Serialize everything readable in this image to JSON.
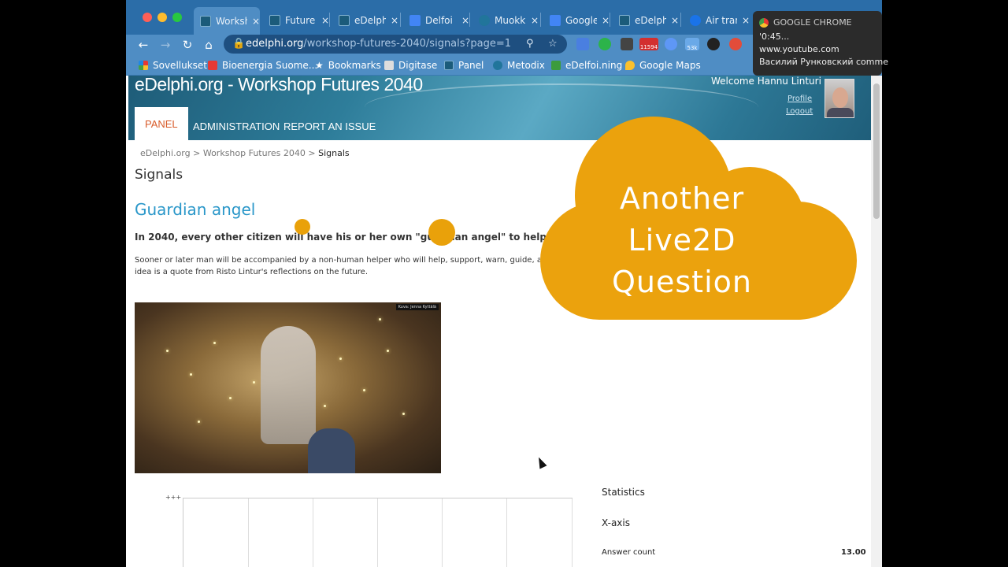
{
  "browser": {
    "tabs": [
      {
        "label": "Worksh",
        "active": true,
        "color": "#1b5b7a"
      },
      {
        "label": "Future",
        "color": "#1b5b7a"
      },
      {
        "label": "eDelphi",
        "color": "#1b5b7a"
      },
      {
        "label": "Delfoi",
        "color": "#4285f4"
      },
      {
        "label": "Muokk",
        "color": "#21759b"
      },
      {
        "label": "Google",
        "color": "#4285f4"
      },
      {
        "label": "eDelphi",
        "color": "#1b5b7a"
      },
      {
        "label": "Air tran",
        "color": "#1a73e8"
      }
    ],
    "tab_close": "×",
    "url_host": "edelphi.org",
    "url_path": "/workshop-futures-2040/signals?page=1",
    "extension_badge": "11594",
    "extension_badge2": "53k",
    "bookmarks": [
      {
        "label": "Sovellukset"
      },
      {
        "label": "Bioenergia Suome..."
      },
      {
        "label": "Bookmarks"
      },
      {
        "label": "Digitase"
      },
      {
        "label": "Panel"
      },
      {
        "label": "Metodix"
      },
      {
        "label": "eDelfoi.ning"
      },
      {
        "label": "Google Maps"
      }
    ]
  },
  "notification": {
    "app": "GOOGLE CHROME",
    "line1": "'0:45...",
    "line2": "www.youtube.com",
    "line3": "Василий Рунковский comme"
  },
  "site": {
    "title": "eDelphi.org - Workshop Futures 2040",
    "welcome": "Welcome  Hannu Linturi",
    "profile": "Profile",
    "logout": "Logout",
    "nav": [
      "PANEL",
      "ADMINISTRATION",
      "REPORT AN ISSUE"
    ]
  },
  "breadcrumb": {
    "root": "eDelphi.org",
    "sep": ">",
    "mid": "Workshop Futures 2040",
    "current": "Signals"
  },
  "content": {
    "section_title": "Signals",
    "signal_title": "Guardian angel",
    "lead": "In 2040, every other citizen will have his or her own \"guardian angel\" to help and take care of y",
    "body1": "Sooner or later man will be accompanied by a non-human helper who will help, support, warn, guide, and ment",
    "body1_end": "d",
    "body2": "idea is a quote from Risto Lintur's reflections on the future.",
    "photo_credit": "Kuva: Jenna Kyttälä",
    "chart_tick": "+++"
  },
  "stats": {
    "title": "Statistics",
    "xaxis": "X-axis",
    "answer_label": "Answer count",
    "answer_value": "13.00"
  },
  "overlay": {
    "line1": "Another",
    "line2": "Live2D",
    "line3": "Question",
    "color": "#eba20d"
  }
}
